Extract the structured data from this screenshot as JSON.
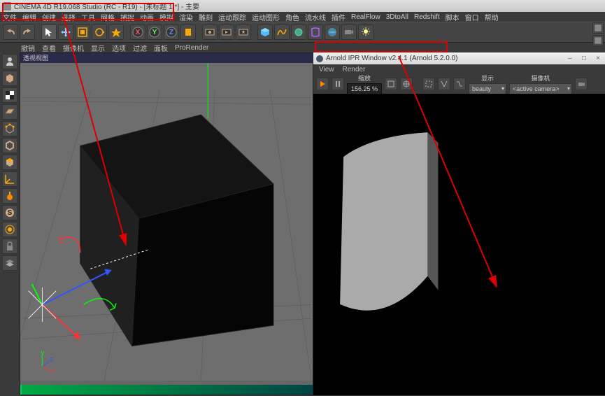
{
  "title": "CINEMA 4D R19.068 Studio (RC - R19) - [未标题 1 *] - 主要",
  "menu": [
    "文件",
    "编辑",
    "创建",
    "选择",
    "工具",
    "网格",
    "捕捉",
    "动画",
    "模拟",
    "渲染",
    "雕刻",
    "运动跟踪",
    "运动图形",
    "角色",
    "流水线",
    "插件",
    "RealFlow",
    "3DtoAll",
    "Redshift",
    "脚本",
    "窗口",
    "帮助"
  ],
  "tabs": [
    "撤销",
    "查看",
    "摄像机",
    "显示",
    "选项",
    "过滤",
    "面板",
    "ProRender"
  ],
  "vptitle": "透视视图",
  "ipr": {
    "title": "Arnold IPR Window v2.4.1 (Arnold 5.2.0.0)",
    "menu": [
      "View",
      "Render"
    ],
    "cols": {
      "scale": "缩放",
      "scale_val": "156.25 %",
      "disp": "显示",
      "disp_val": "beauty",
      "cam": "摄像机",
      "cam_val": "<active camera>"
    }
  }
}
